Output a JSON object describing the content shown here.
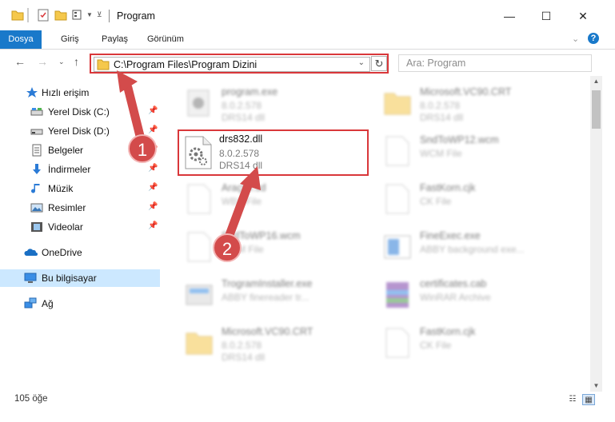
{
  "window": {
    "title": "Program",
    "minimize": "—",
    "maximize": "☐",
    "close": "✕"
  },
  "ribbon": {
    "tabs": [
      "Dosya",
      "Giriş",
      "Paylaş",
      "Görünüm"
    ],
    "expand": "⌄",
    "help": "?"
  },
  "address": {
    "path": "C:\\Program Files\\Program Dizini",
    "search_placeholder": "Ara: Program"
  },
  "sidebar": {
    "items": [
      {
        "label": "Hızlı erişim",
        "icon": "star-icon"
      },
      {
        "label": "Yerel Disk (C:)",
        "icon": "drive-icon",
        "pinned": true
      },
      {
        "label": "Yerel Disk (D:)",
        "icon": "drive-icon",
        "pinned": true
      },
      {
        "label": "Belgeler",
        "icon": "documents-icon",
        "pinned": true
      },
      {
        "label": "İndirmeler",
        "icon": "download-icon",
        "pinned": true
      },
      {
        "label": "Müzik",
        "icon": "music-icon",
        "pinned": true
      },
      {
        "label": "Resimler",
        "icon": "pictures-icon",
        "pinned": true
      },
      {
        "label": "Videolar",
        "icon": "videos-icon",
        "pinned": true
      },
      {
        "label": "OneDrive",
        "icon": "cloud-icon"
      },
      {
        "label": "Bu bilgisayar",
        "icon": "computer-icon",
        "selected": true
      },
      {
        "label": "Ağ",
        "icon": "network-icon"
      }
    ]
  },
  "files": {
    "highlighted": {
      "name": "drs832.dll",
      "version": "8.0.2.578",
      "desc": "DRS14 dll"
    },
    "left_column": [
      {
        "name": "program.exe",
        "l2": "8.0.2.578",
        "l3": "DRS14 dll"
      },
      {
        "name": "Araçlar.sd",
        "l2": "WBS File",
        "l3": ""
      },
      {
        "name": "SndToWP16.wcm",
        "l2": "WCM File",
        "l3": ""
      },
      {
        "name": "TrogramInstaller.exe",
        "l2": "ABBY finereader tr...",
        "l3": ""
      },
      {
        "name": "Microsoft.VC90.CRT",
        "l2": "8.0.2.578",
        "l3": "DRS14 dll"
      }
    ],
    "right_column": [
      {
        "name": "Microsoft.VC90.CRT",
        "l2": "8.0.2.578",
        "l3": "DRS14 dll"
      },
      {
        "name": "SndToWP12.wcm",
        "l2": "WCM File",
        "l3": ""
      },
      {
        "name": "FastKorn.cjk",
        "l2": "CK File",
        "l3": ""
      },
      {
        "name": "FineExec.exe",
        "l2": "ABBY background exe...",
        "l3": ""
      },
      {
        "name": "certificates.cab",
        "l2": "WinRAR Archive",
        "l3": ""
      },
      {
        "name": "FastKorn.cjk",
        "l2": "CK File",
        "l3": ""
      }
    ]
  },
  "status": {
    "count": "105 öğe"
  },
  "callouts": [
    "1",
    "2"
  ],
  "colors": {
    "accent": "#1979ca",
    "highlight": "#d9373a",
    "selected": "#cce8ff"
  }
}
